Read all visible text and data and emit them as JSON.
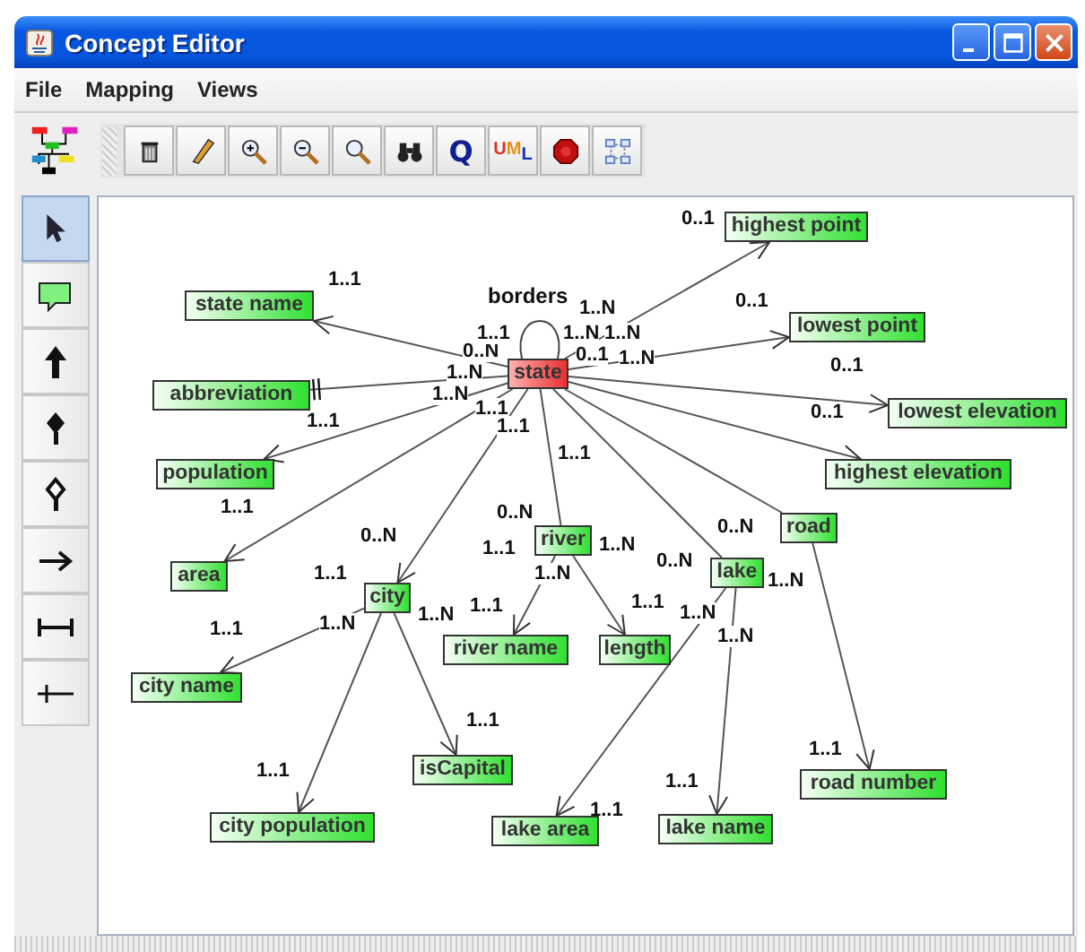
{
  "window": {
    "title": "Concept Editor"
  },
  "menu": [
    "File",
    "Mapping",
    "Views"
  ],
  "toolbar": [
    {
      "kind": "trash"
    },
    {
      "kind": "pencil"
    },
    {
      "kind": "zoom-in"
    },
    {
      "kind": "zoom-out"
    },
    {
      "kind": "zoom"
    },
    {
      "kind": "binoculars"
    },
    {
      "kind": "text",
      "text": "Q"
    },
    {
      "kind": "uml",
      "text": "UML"
    },
    {
      "kind": "stop"
    },
    {
      "kind": "layout"
    }
  ],
  "palette": [
    {
      "kind": "pointer",
      "selected": true
    },
    {
      "kind": "note",
      "selected": false
    },
    {
      "kind": "arrow",
      "selected": false
    },
    {
      "kind": "diamond",
      "selected": false
    },
    {
      "kind": "hollow-diamond",
      "selected": false
    },
    {
      "kind": "right-arrow",
      "selected": false
    },
    {
      "kind": "double-bar",
      "selected": false
    },
    {
      "kind": "bar",
      "selected": false
    }
  ],
  "diagram": {
    "self_relation": {
      "name": "borders",
      "labels": [
        "1..N",
        "0..N"
      ]
    },
    "root": {
      "label": "state",
      "selected": true,
      "children": [
        {
          "label": "highest point",
          "selected": false,
          "kind": "arrow",
          "end_label": "0..1",
          "start_label": "1..N"
        },
        {
          "label": "lowest point",
          "selected": false,
          "kind": "arrow",
          "end_label": "0..1",
          "start_label": "1..N"
        },
        {
          "label": "lowest elevation",
          "selected": false,
          "kind": "arrow",
          "end_label": "0..1",
          "start_label": "0..1"
        },
        {
          "label": "highest elevation",
          "selected": false,
          "kind": "arrow",
          "end_label": "0..1",
          "start_label": "1..N"
        },
        {
          "label": "state name",
          "selected": false,
          "kind": "arrow",
          "end_label": "1..1",
          "start_label": "1..N"
        },
        {
          "label": "abbreviation",
          "selected": false,
          "kind": "bar",
          "start_label": "1..N"
        },
        {
          "label": "population",
          "selected": false,
          "kind": "arrow",
          "end_label": "1..1",
          "start_label": "1..1"
        },
        {
          "label": "area",
          "selected": false,
          "kind": "arrow",
          "end_label": "1..1",
          "start_label": "1..1"
        },
        {
          "label": "city",
          "selected": false,
          "kind": "arrow",
          "end_label": "0..N",
          "start_label": "1..1",
          "children": [
            {
              "label": "city name",
              "selected": false,
              "kind": "arrow",
              "end_label": "1..1",
              "start_label": "1..N"
            },
            {
              "label": "city population",
              "selected": false,
              "kind": "arrow",
              "end_label": "1..1",
              "start_label": "1..1"
            },
            {
              "label": "isCapital",
              "selected": false,
              "kind": "arrow",
              "end_label": "1..1",
              "start_label": "1..N"
            }
          ]
        },
        {
          "label": "river",
          "selected": false,
          "kind": "plain",
          "end_label": "0..N",
          "start_label": "1..1",
          "children": [
            {
              "label": "river name",
              "selected": false,
              "kind": "arrow",
              "end_label": "1..1",
              "start_label": "1..N"
            },
            {
              "label": "length",
              "selected": false,
              "kind": "arrow",
              "end_label": "1..1",
              "start_label": "1..N"
            }
          ]
        },
        {
          "label": "lake",
          "selected": false,
          "kind": "plain",
          "end_label": "0..N",
          "start_label": "1..1",
          "children": [
            {
              "label": "lake area",
              "selected": false,
              "kind": "arrow",
              "end_label": "1..1",
              "start_label": "1..N"
            },
            {
              "label": "lake name",
              "selected": false,
              "kind": "arrow",
              "end_label": "1..1",
              "start_label": "1..N"
            }
          ]
        },
        {
          "label": "road",
          "selected": false,
          "kind": "plain",
          "end_label": "0..N",
          "start_label": "1..N",
          "children": [
            {
              "label": "road number",
              "selected": false,
              "kind": "arrow",
              "end_label": "1..1"
            }
          ]
        }
      ]
    }
  }
}
